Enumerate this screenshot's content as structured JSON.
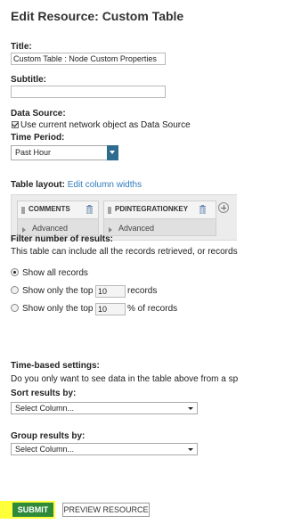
{
  "page": {
    "heading": "Edit Resource: Custom Table"
  },
  "title": {
    "label": "Title:",
    "value": "Custom Table  : Node Custom Properties"
  },
  "subtitle": {
    "label": "Subtitle:",
    "value": ""
  },
  "data_source": {
    "label": "Data Source:",
    "checkbox_label": "Use current network object as Data Source",
    "checked": true
  },
  "time_period": {
    "label": "Time Period:",
    "selected": "Past Hour"
  },
  "table_layout": {
    "label": "Table layout:",
    "edit_link": "Edit column widths",
    "columns": [
      {
        "name": "COMMENTS",
        "advanced": "Advanced"
      },
      {
        "name": "PDINTEGRATIONKEY",
        "advanced": "Advanced"
      }
    ],
    "icons": {
      "delete": "trash-icon",
      "add": "plus-circle-icon",
      "grip": "drag-grip-icon",
      "expand": "expand-triangle-icon"
    }
  },
  "filter": {
    "label": "Filter number of results:",
    "description": "This table can include all the records retrieved, or records",
    "options": [
      {
        "label": "Show all records",
        "selected": true
      },
      {
        "prefix": "Show only the top",
        "value": "10",
        "suffix": "records",
        "selected": false
      },
      {
        "prefix": "Show only the top",
        "value": "10",
        "suffix": "% of records",
        "selected": false
      }
    ]
  },
  "time_based": {
    "label": "Time-based settings:",
    "description": "Do you only want to see data in the table above from a sp"
  },
  "sort": {
    "label": "Sort results by:",
    "selected": "Select Column..."
  },
  "group": {
    "label": "Group results by:",
    "selected": "Select Column..."
  },
  "buttons": {
    "submit": "SUBMIT",
    "preview": "PREVIEW RESOURCE"
  },
  "colors": {
    "submit_bg": "#2f8a3a",
    "highlight": "#ffff3a",
    "dropdown_button": "#2d6b8f",
    "link": "#2f7bbd"
  }
}
